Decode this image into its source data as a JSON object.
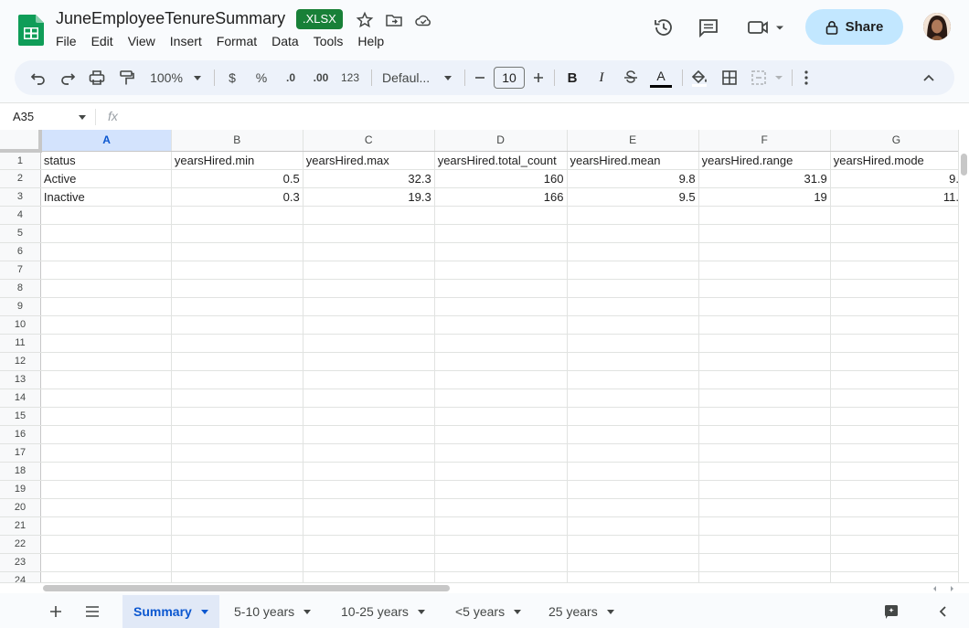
{
  "app": {
    "doc_title": "JuneEmployeeTenureSummary",
    "badge": ".XLSX",
    "share_label": "Share"
  },
  "menu": [
    "File",
    "Edit",
    "View",
    "Insert",
    "Format",
    "Data",
    "Tools",
    "Help"
  ],
  "toolbar": {
    "zoom": "100%",
    "currency": "$",
    "percent": "%",
    "dec_decrease": ".0",
    "dec_increase": ".00",
    "number_format": "123",
    "font": "Defaul...",
    "font_size": "10",
    "bold": "B",
    "italic": "I",
    "text_color": "A"
  },
  "formula": {
    "cell_ref": "A35",
    "fx": "fx"
  },
  "columns": [
    "A",
    "B",
    "C",
    "D",
    "E",
    "F",
    "G"
  ],
  "rows": [
    {
      "n": "1",
      "cells": [
        "status",
        "yearsHired.min",
        "yearsHired.max",
        "yearsHired.total_count",
        "yearsHired.mean",
        "yearsHired.range",
        "yearsHired.mode"
      ]
    },
    {
      "n": "2",
      "cells": [
        "Active",
        "0.5",
        "32.3",
        "160",
        "9.8",
        "31.9",
        "9."
      ]
    },
    {
      "n": "3",
      "cells": [
        "Inactive",
        "0.3",
        "19.3",
        "166",
        "9.5",
        "19",
        "11."
      ]
    },
    {
      "n": "4",
      "cells": [
        "",
        "",
        "",
        "",
        "",
        "",
        ""
      ]
    },
    {
      "n": "5",
      "cells": [
        "",
        "",
        "",
        "",
        "",
        "",
        ""
      ]
    },
    {
      "n": "6",
      "cells": [
        "",
        "",
        "",
        "",
        "",
        "",
        ""
      ]
    },
    {
      "n": "7",
      "cells": [
        "",
        "",
        "",
        "",
        "",
        "",
        ""
      ]
    },
    {
      "n": "8",
      "cells": [
        "",
        "",
        "",
        "",
        "",
        "",
        ""
      ]
    },
    {
      "n": "9",
      "cells": [
        "",
        "",
        "",
        "",
        "",
        "",
        ""
      ]
    },
    {
      "n": "10",
      "cells": [
        "",
        "",
        "",
        "",
        "",
        "",
        ""
      ]
    },
    {
      "n": "11",
      "cells": [
        "",
        "",
        "",
        "",
        "",
        "",
        ""
      ]
    },
    {
      "n": "12",
      "cells": [
        "",
        "",
        "",
        "",
        "",
        "",
        ""
      ]
    },
    {
      "n": "13",
      "cells": [
        "",
        "",
        "",
        "",
        "",
        "",
        ""
      ]
    },
    {
      "n": "14",
      "cells": [
        "",
        "",
        "",
        "",
        "",
        "",
        ""
      ]
    },
    {
      "n": "15",
      "cells": [
        "",
        "",
        "",
        "",
        "",
        "",
        ""
      ]
    },
    {
      "n": "16",
      "cells": [
        "",
        "",
        "",
        "",
        "",
        "",
        ""
      ]
    },
    {
      "n": "17",
      "cells": [
        "",
        "",
        "",
        "",
        "",
        "",
        ""
      ]
    },
    {
      "n": "18",
      "cells": [
        "",
        "",
        "",
        "",
        "",
        "",
        ""
      ]
    },
    {
      "n": "19",
      "cells": [
        "",
        "",
        "",
        "",
        "",
        "",
        ""
      ]
    },
    {
      "n": "20",
      "cells": [
        "",
        "",
        "",
        "",
        "",
        "",
        ""
      ]
    },
    {
      "n": "21",
      "cells": [
        "",
        "",
        "",
        "",
        "",
        "",
        ""
      ]
    },
    {
      "n": "22",
      "cells": [
        "",
        "",
        "",
        "",
        "",
        "",
        ""
      ]
    },
    {
      "n": "23",
      "cells": [
        "",
        "",
        "",
        "",
        "",
        "",
        ""
      ]
    },
    {
      "n": "24",
      "cells": [
        "",
        "",
        "",
        "",
        "",
        "",
        ""
      ]
    }
  ],
  "sheets": [
    {
      "label": "Summary",
      "active": true
    },
    {
      "label": "5-10 years",
      "active": false
    },
    {
      "label": "10-25 years",
      "active": false
    },
    {
      "label": "<5 years",
      "active": false
    },
    {
      "label": "25 years",
      "active": false
    }
  ],
  "colors": {
    "sheets_green": "#0f9d58",
    "xlsx_badge": "#188038",
    "share_bg": "#c2e7ff",
    "active_col_header": "#d3e3fd",
    "active_tab_text": "#0b57d0"
  }
}
